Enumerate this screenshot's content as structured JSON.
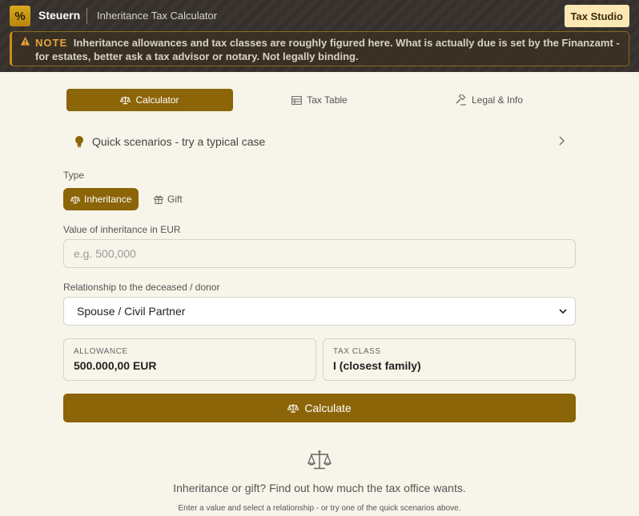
{
  "header": {
    "logo_symbol": "%",
    "brand": "Steuern",
    "title": "Inheritance Tax Calculator",
    "studio_badge": "Tax Studio"
  },
  "note": {
    "label": "NOTE",
    "text": "Inheritance allowances and tax classes are roughly figured here. What is actually due is set by the Finanzamt - for estates, better ask a tax advisor or notary. Not legally binding."
  },
  "tabs": [
    {
      "label": "Calculator",
      "icon": "scale-icon",
      "active": true
    },
    {
      "label": "Tax Table",
      "icon": "table-icon",
      "active": false
    },
    {
      "label": "Legal & Info",
      "icon": "gavel-icon",
      "active": false
    }
  ],
  "scenarios": {
    "label": "Quick scenarios - try a typical case"
  },
  "type": {
    "label": "Type",
    "options": [
      {
        "label": "Inheritance",
        "icon": "scale-icon",
        "selected": true
      },
      {
        "label": "Gift",
        "icon": "gift-icon",
        "selected": false
      }
    ]
  },
  "value_field": {
    "label": "Value of inheritance in EUR",
    "placeholder": "e.g. 500,000",
    "value": ""
  },
  "relationship": {
    "label": "Relationship to the deceased / donor",
    "selected": "Spouse / Civil Partner"
  },
  "allowance": {
    "caption": "ALLOWANCE",
    "value": "500.000,00 EUR"
  },
  "tax_class": {
    "caption": "TAX CLASS",
    "value": "I (closest family)"
  },
  "calculate_button": {
    "label": "Calculate"
  },
  "empty_state": {
    "title": "Inheritance or gift? Find out how much the tax office wants.",
    "subtitle": "Enter a value and select a relationship - or try one of the quick scenarios above."
  },
  "colors": {
    "accent": "#8b6508",
    "header_bg": "#383330",
    "note_label": "#e8a33b",
    "page_bg": "#f7f4ea"
  }
}
